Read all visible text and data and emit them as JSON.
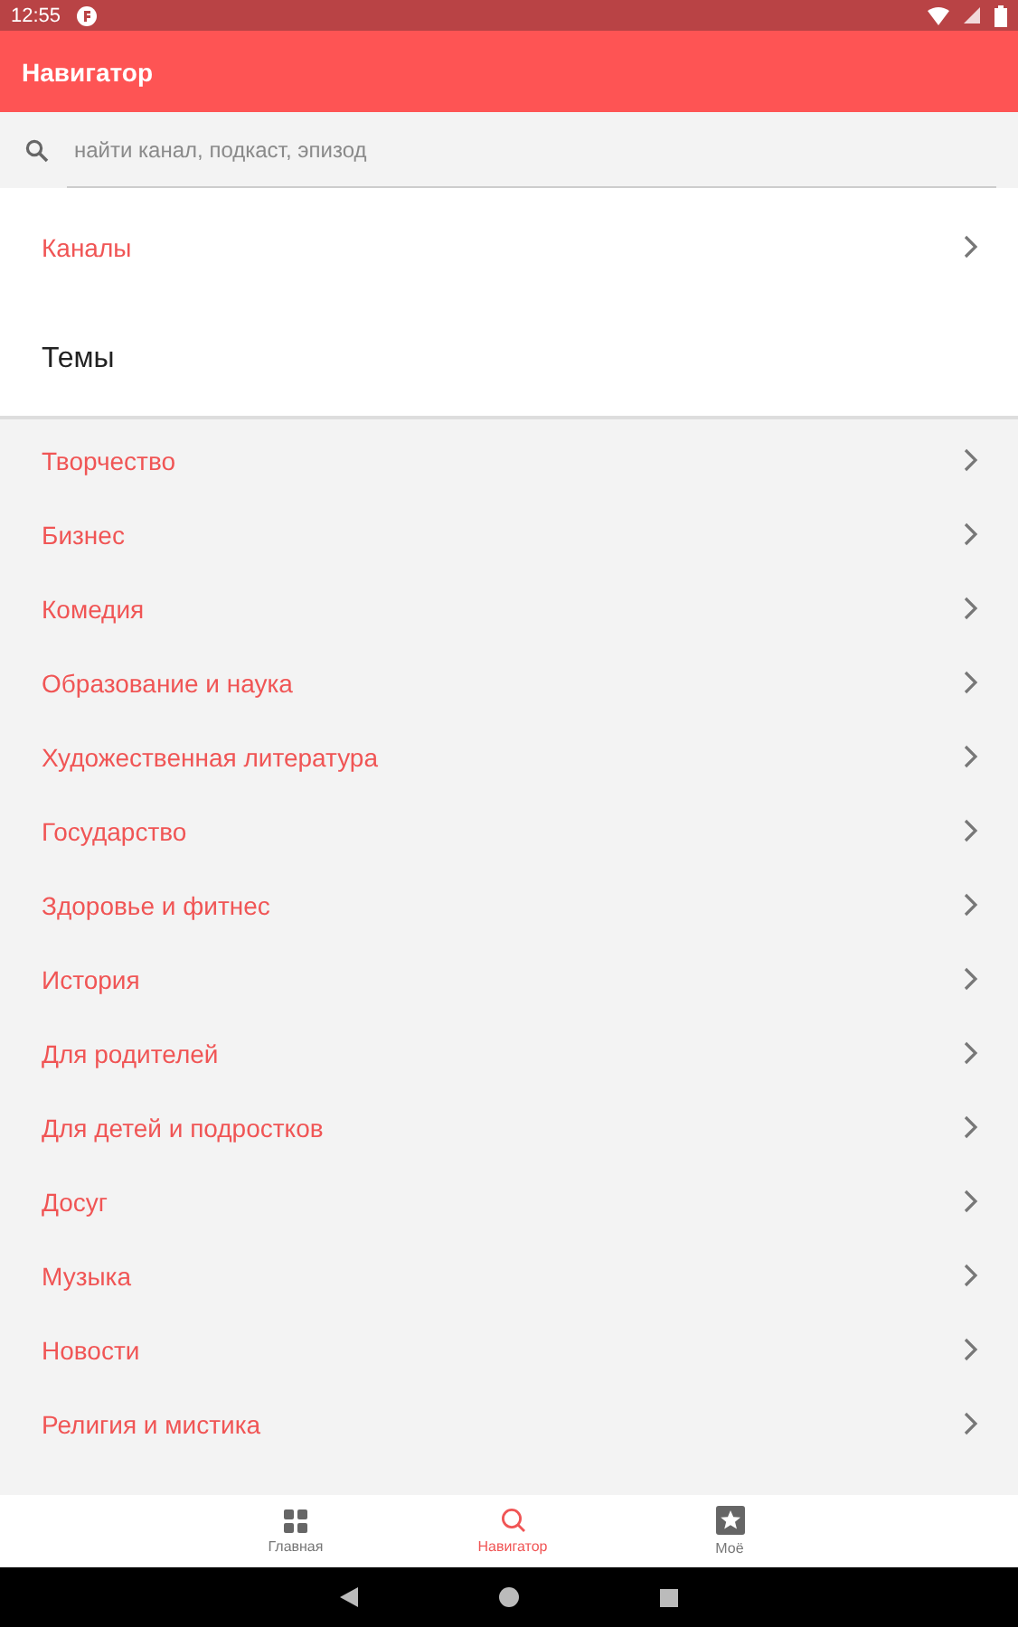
{
  "status_bar": {
    "time": "12:55"
  },
  "app_bar": {
    "title": "Навигатор"
  },
  "search": {
    "placeholder": "найти канал, подкаст, эпизод"
  },
  "channels": {
    "label": "Каналы"
  },
  "topics": {
    "title": "Темы",
    "items": [
      {
        "label": "Творчество"
      },
      {
        "label": "Бизнес"
      },
      {
        "label": "Комедия"
      },
      {
        "label": "Образование и наука"
      },
      {
        "label": "Художественная литература"
      },
      {
        "label": "Государство"
      },
      {
        "label": "Здоровье и фитнес"
      },
      {
        "label": "История"
      },
      {
        "label": "Для родителей"
      },
      {
        "label": "Для детей и подростков"
      },
      {
        "label": "Досуг"
      },
      {
        "label": "Музыка"
      },
      {
        "label": "Новости"
      },
      {
        "label": "Религия и мистика"
      }
    ]
  },
  "bottom_nav": [
    {
      "label": "Главная",
      "kind": "grid",
      "selected": false
    },
    {
      "label": "Навигатор",
      "kind": "search",
      "selected": true
    },
    {
      "label": "Моё",
      "kind": "star",
      "selected": false
    }
  ]
}
